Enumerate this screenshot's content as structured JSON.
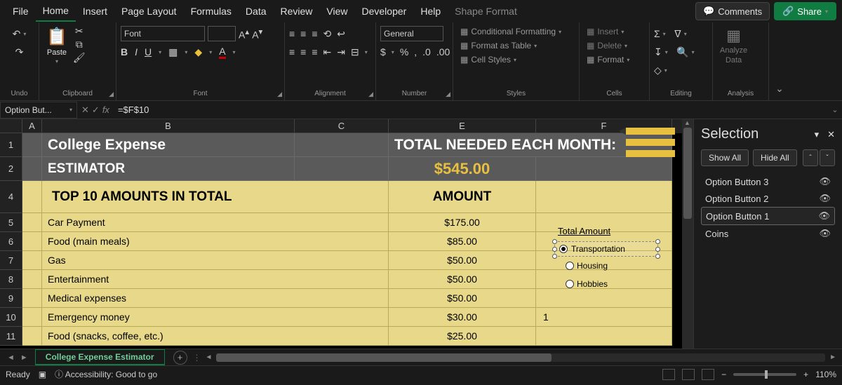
{
  "menu": {
    "file": "File",
    "home": "Home",
    "insert": "Insert",
    "pagelayout": "Page Layout",
    "formulas": "Formulas",
    "data": "Data",
    "review": "Review",
    "view": "View",
    "developer": "Developer",
    "help": "Help",
    "shapeformat": "Shape Format",
    "comments": "Comments",
    "share": "Share"
  },
  "ribbon": {
    "undo": "Undo",
    "clipboard": "Clipboard",
    "paste": "Paste",
    "font": "Font",
    "alignment": "Alignment",
    "number": "Number",
    "number_format": "General",
    "styles": "Styles",
    "cond_fmt": "Conditional Formatting",
    "fmt_table": "Format as Table",
    "cell_styles": "Cell Styles",
    "cells": "Cells",
    "insert_c": "Insert",
    "delete_c": "Delete",
    "format_c": "Format",
    "editing": "Editing",
    "analysis": "Analysis",
    "analyze": "Analyze",
    "analyze2": "Data"
  },
  "formula": {
    "namebox": "Option But...",
    "value": "=$F$10"
  },
  "cols": {
    "A": "A",
    "B": "B",
    "C": "C",
    "E": "E",
    "F": "F"
  },
  "sheet": {
    "title": "College Expense",
    "subtitle": "ESTIMATOR",
    "total_label": "TOTAL NEEDED EACH MONTH:",
    "total_value": "$545.00",
    "list_header": "TOP 10 AMOUNTS IN TOTAL",
    "amount_header": "AMOUNT",
    "rows": [
      {
        "n": "5",
        "label": "Car Payment",
        "amt": "$175.00"
      },
      {
        "n": "6",
        "label": "Food (main meals)",
        "amt": "$85.00"
      },
      {
        "n": "7",
        "label": "Gas",
        "amt": "$50.00"
      },
      {
        "n": "8",
        "label": "Entertainment",
        "amt": "$50.00"
      },
      {
        "n": "9",
        "label": "Medical expenses",
        "amt": "$50.00"
      },
      {
        "n": "10",
        "label": "Emergency money",
        "amt": "$30.00"
      },
      {
        "n": "11",
        "label": "Food (snacks, coffee, etc.)",
        "amt": "$25.00"
      }
    ],
    "f_total_label": "Total Amount",
    "f10": "1",
    "opt1": "Transportation",
    "opt2": "Housing",
    "opt3": "Hobbies",
    "row1": "1",
    "row2": "2",
    "row4": "4"
  },
  "selection": {
    "title": "Selection",
    "showall": "Show All",
    "hideall": "Hide All",
    "items": [
      "Option Button 3",
      "Option Button 2",
      "Option Button 1",
      "Coins"
    ],
    "selected": "Option Button 1"
  },
  "tabs": {
    "sheet": "College Expense Estimator"
  },
  "status": {
    "ready": "Ready",
    "access": "Accessibility: Good to go",
    "zoom": "110%"
  }
}
